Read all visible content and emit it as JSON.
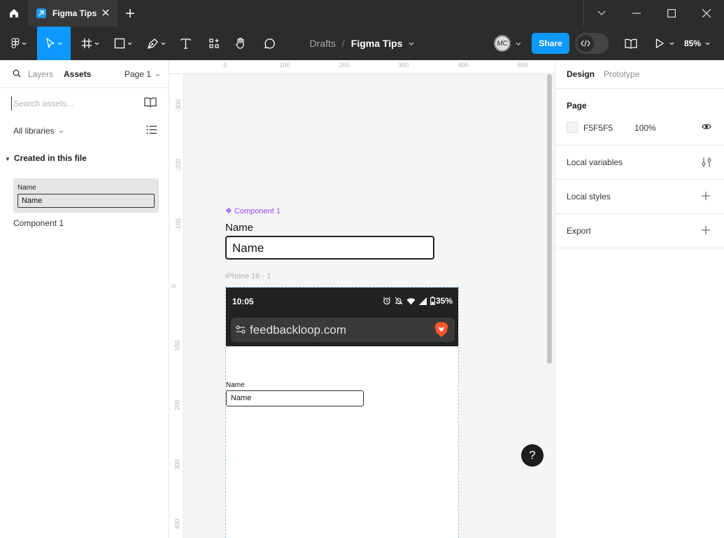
{
  "window": {
    "tab_title": "Figma Tips"
  },
  "toolbar": {
    "breadcrumb_drafts": "Drafts",
    "breadcrumb_sep": "/",
    "file_name": "Figma Tips",
    "avatar_initials": "MC",
    "share_label": "Share",
    "zoom": "85%"
  },
  "left_panel": {
    "tab_layers": "Layers",
    "tab_assets": "Assets",
    "page_selector": "Page 1",
    "search_placeholder": "Search assets...",
    "libraries_label": "All libraries",
    "section_title": "Created in this file",
    "thumb_label": "Name",
    "thumb_field": "Name",
    "component_name": "Component 1"
  },
  "canvas": {
    "ruler_x": [
      "0",
      "100",
      "200",
      "300",
      "400",
      "500"
    ],
    "ruler_y": [
      "-300",
      "-200",
      "-100",
      "0",
      "100",
      "200",
      "300",
      "400"
    ],
    "component_label": "Component 1",
    "component_field_label": "Name",
    "component_field_value": "Name",
    "frame_label": "iPhone 16 - 1",
    "status_time": "10:05",
    "battery": "35%",
    "url": "feedbackloop.com",
    "inner_label": "Name",
    "inner_field": "Name",
    "help_label": "?"
  },
  "right_panel": {
    "tab_design": "Design",
    "tab_prototype": "Prototype",
    "page_section": "Page",
    "page_color": "F5F5F5",
    "page_opacity": "100%",
    "local_variables": "Local variables",
    "local_styles": "Local styles",
    "export": "Export"
  },
  "colors": {
    "accent": "#0d99ff",
    "component": "#9747ff",
    "chrome": "#2c2c2c",
    "canvas": "#f5f5f5"
  }
}
